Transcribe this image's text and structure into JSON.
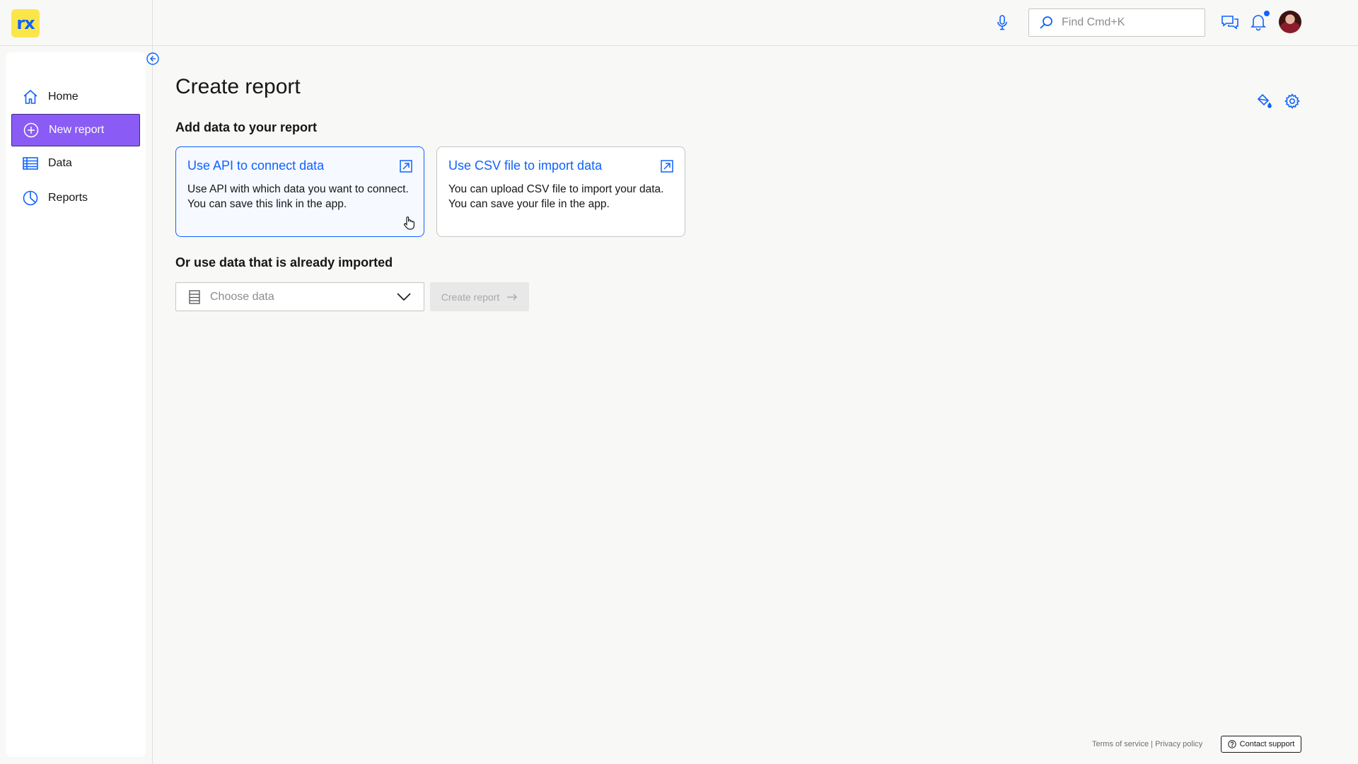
{
  "app": {
    "logo_text": "rx",
    "brand_color": "#0f62fe",
    "logo_bg": "#fae64a"
  },
  "header": {
    "search_placeholder": "Find Cmd+K",
    "icons": [
      "microphone-icon",
      "search-icon",
      "chat-icon",
      "notification-bell-icon",
      "user-avatar"
    ]
  },
  "sidebar": {
    "items": [
      {
        "label": "Home",
        "icon": "home-icon",
        "active": false
      },
      {
        "label": "New report",
        "icon": "add-circle-icon",
        "active": true
      },
      {
        "label": "Data",
        "icon": "table-icon",
        "active": false
      },
      {
        "label": "Reports",
        "icon": "pie-chart-icon",
        "active": false
      }
    ],
    "active_color": "#8a5cf5"
  },
  "main": {
    "title": "Create report",
    "section_add": "Add data to your report",
    "cards": [
      {
        "title": "Use API to connect data",
        "description": "Use API with which data you want to connect. You can save this link in the app."
      },
      {
        "title": "Use CSV file to import data",
        "description": "You can upload CSV file to import your data. You can save your file in the app."
      }
    ],
    "section_existing": "Or use data that is already imported",
    "dropdown_placeholder": "Choose data",
    "create_button": "Create report"
  },
  "footer": {
    "terms": "Terms of service",
    "separator": "|",
    "privacy": "Privacy policy",
    "support": "Contact support"
  }
}
